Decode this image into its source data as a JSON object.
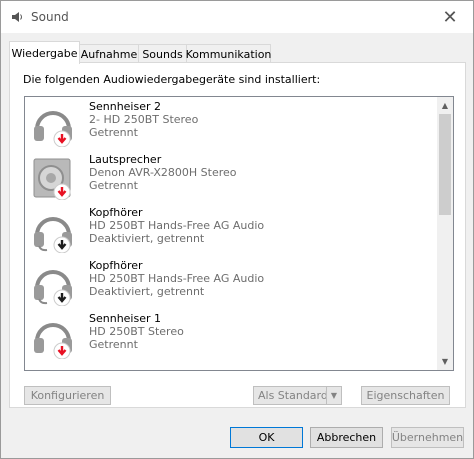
{
  "window": {
    "title": "Sound",
    "close_glyph": "✕"
  },
  "tabs": [
    {
      "label": "Wiedergabe",
      "active": true
    },
    {
      "label": "Aufnahme",
      "active": false
    },
    {
      "label": "Sounds",
      "active": false
    },
    {
      "label": "Kommunikation",
      "active": false
    }
  ],
  "panel": {
    "heading": "Die folgenden Audiowiedergabegeräte sind installiert:"
  },
  "devices": [
    {
      "name": "Sennheiser 2",
      "description": "2- HD 250BT Stereo",
      "status": "Getrennt",
      "icon": "headphones-icon",
      "badge": "disconnected-badge-icon",
      "badge_color": "#e81123"
    },
    {
      "name": "Lautsprecher",
      "description": "Denon AVR-X2800H Stereo",
      "status": "Getrennt",
      "icon": "speaker-icon",
      "badge": "disconnected-badge-icon",
      "badge_color": "#e81123"
    },
    {
      "name": "Kopfhörer",
      "description": "HD 250BT Hands-Free AG Audio",
      "status": "Deaktiviert, getrennt",
      "icon": "headset-icon",
      "badge": "disabled-badge-icon",
      "badge_color": "#1e1e1e"
    },
    {
      "name": "Kopfhörer",
      "description": "HD 250BT Hands-Free AG Audio",
      "status": "Deaktiviert, getrennt",
      "icon": "headset-icon",
      "badge": "disabled-badge-icon",
      "badge_color": "#1e1e1e"
    },
    {
      "name": "Sennheiser 1",
      "description": "HD 250BT Stereo",
      "status": "Getrennt",
      "icon": "headphones-icon",
      "badge": "disconnected-badge-icon",
      "badge_color": "#e81123"
    }
  ],
  "scrollbar": {
    "up": "▲",
    "down": "▼"
  },
  "panel_buttons": {
    "configure": "Konfigurieren",
    "set_default": "Als Standard",
    "properties": "Eigenschaften",
    "split_arrow": "▼"
  },
  "dialog_buttons": {
    "ok": "OK",
    "cancel": "Abbrechen",
    "apply": "Übernehmen"
  }
}
